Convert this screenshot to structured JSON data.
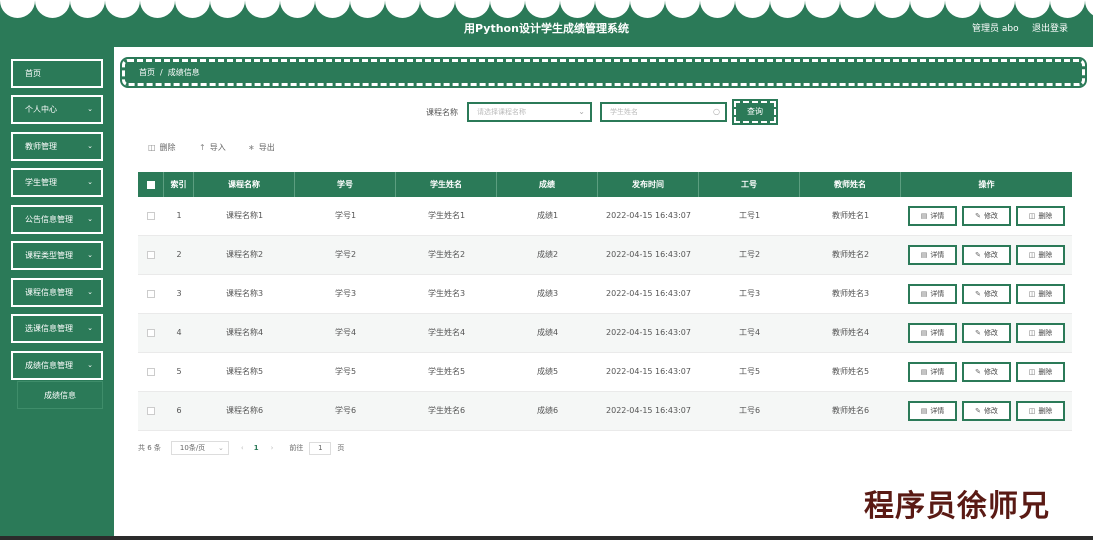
{
  "header": {
    "title": "用Python设计学生成绩管理系统",
    "user": "管理员 abo",
    "logout": "退出登录"
  },
  "sidebar": {
    "items": [
      {
        "label": "首页",
        "has_chevron": false
      },
      {
        "label": "个人中心",
        "has_chevron": true
      },
      {
        "label": "教师管理",
        "has_chevron": true
      },
      {
        "label": "学生管理",
        "has_chevron": true
      },
      {
        "label": "公告信息管理",
        "has_chevron": true
      },
      {
        "label": "课程类型管理",
        "has_chevron": true
      },
      {
        "label": "课程信息管理",
        "has_chevron": true
      },
      {
        "label": "选课信息管理",
        "has_chevron": true
      },
      {
        "label": "成绩信息管理",
        "has_chevron": true
      }
    ],
    "sub_item": "成绩信息"
  },
  "breadcrumb": {
    "home": "首页",
    "separator": "/",
    "current": "成绩信息"
  },
  "search": {
    "label": "课程名称",
    "course_placeholder": "请选择课程名称",
    "student_placeholder": "学生姓名",
    "button": "查询"
  },
  "toolbar": {
    "delete": "删除",
    "import": "导入",
    "export": "导出"
  },
  "table": {
    "headers": [
      "索引",
      "课程名称",
      "学号",
      "学生姓名",
      "成绩",
      "发布时间",
      "工号",
      "教师姓名",
      "操作"
    ],
    "rows": [
      {
        "index": "1",
        "course": "课程名称1",
        "sno": "学号1",
        "sname": "学生姓名1",
        "score": "成绩1",
        "time": "2022-04-15 16:43:07",
        "tno": "工号1",
        "tname": "教师姓名1"
      },
      {
        "index": "2",
        "course": "课程名称2",
        "sno": "学号2",
        "sname": "学生姓名2",
        "score": "成绩2",
        "time": "2022-04-15 16:43:07",
        "tno": "工号2",
        "tname": "教师姓名2"
      },
      {
        "index": "3",
        "course": "课程名称3",
        "sno": "学号3",
        "sname": "学生姓名3",
        "score": "成绩3",
        "time": "2022-04-15 16:43:07",
        "tno": "工号3",
        "tname": "教师姓名3"
      },
      {
        "index": "4",
        "course": "课程名称4",
        "sno": "学号4",
        "sname": "学生姓名4",
        "score": "成绩4",
        "time": "2022-04-15 16:43:07",
        "tno": "工号4",
        "tname": "教师姓名4"
      },
      {
        "index": "5",
        "course": "课程名称5",
        "sno": "学号5",
        "sname": "学生姓名5",
        "score": "成绩5",
        "time": "2022-04-15 16:43:07",
        "tno": "工号5",
        "tname": "教师姓名5"
      },
      {
        "index": "6",
        "course": "课程名称6",
        "sno": "学号6",
        "sname": "学生姓名6",
        "score": "成绩6",
        "time": "2022-04-15 16:43:07",
        "tno": "工号6",
        "tname": "教师姓名6"
      }
    ],
    "actions": {
      "detail": "详情",
      "edit": "修改",
      "delete": "删除"
    }
  },
  "pagination": {
    "total": "共 6 条",
    "page_size": "10条/页",
    "current": "1",
    "goto_label": "前往",
    "goto_value": "1",
    "unit": "页"
  },
  "watermark": "程序员徐师兄",
  "colors": {
    "primary": "#2b7a58"
  }
}
